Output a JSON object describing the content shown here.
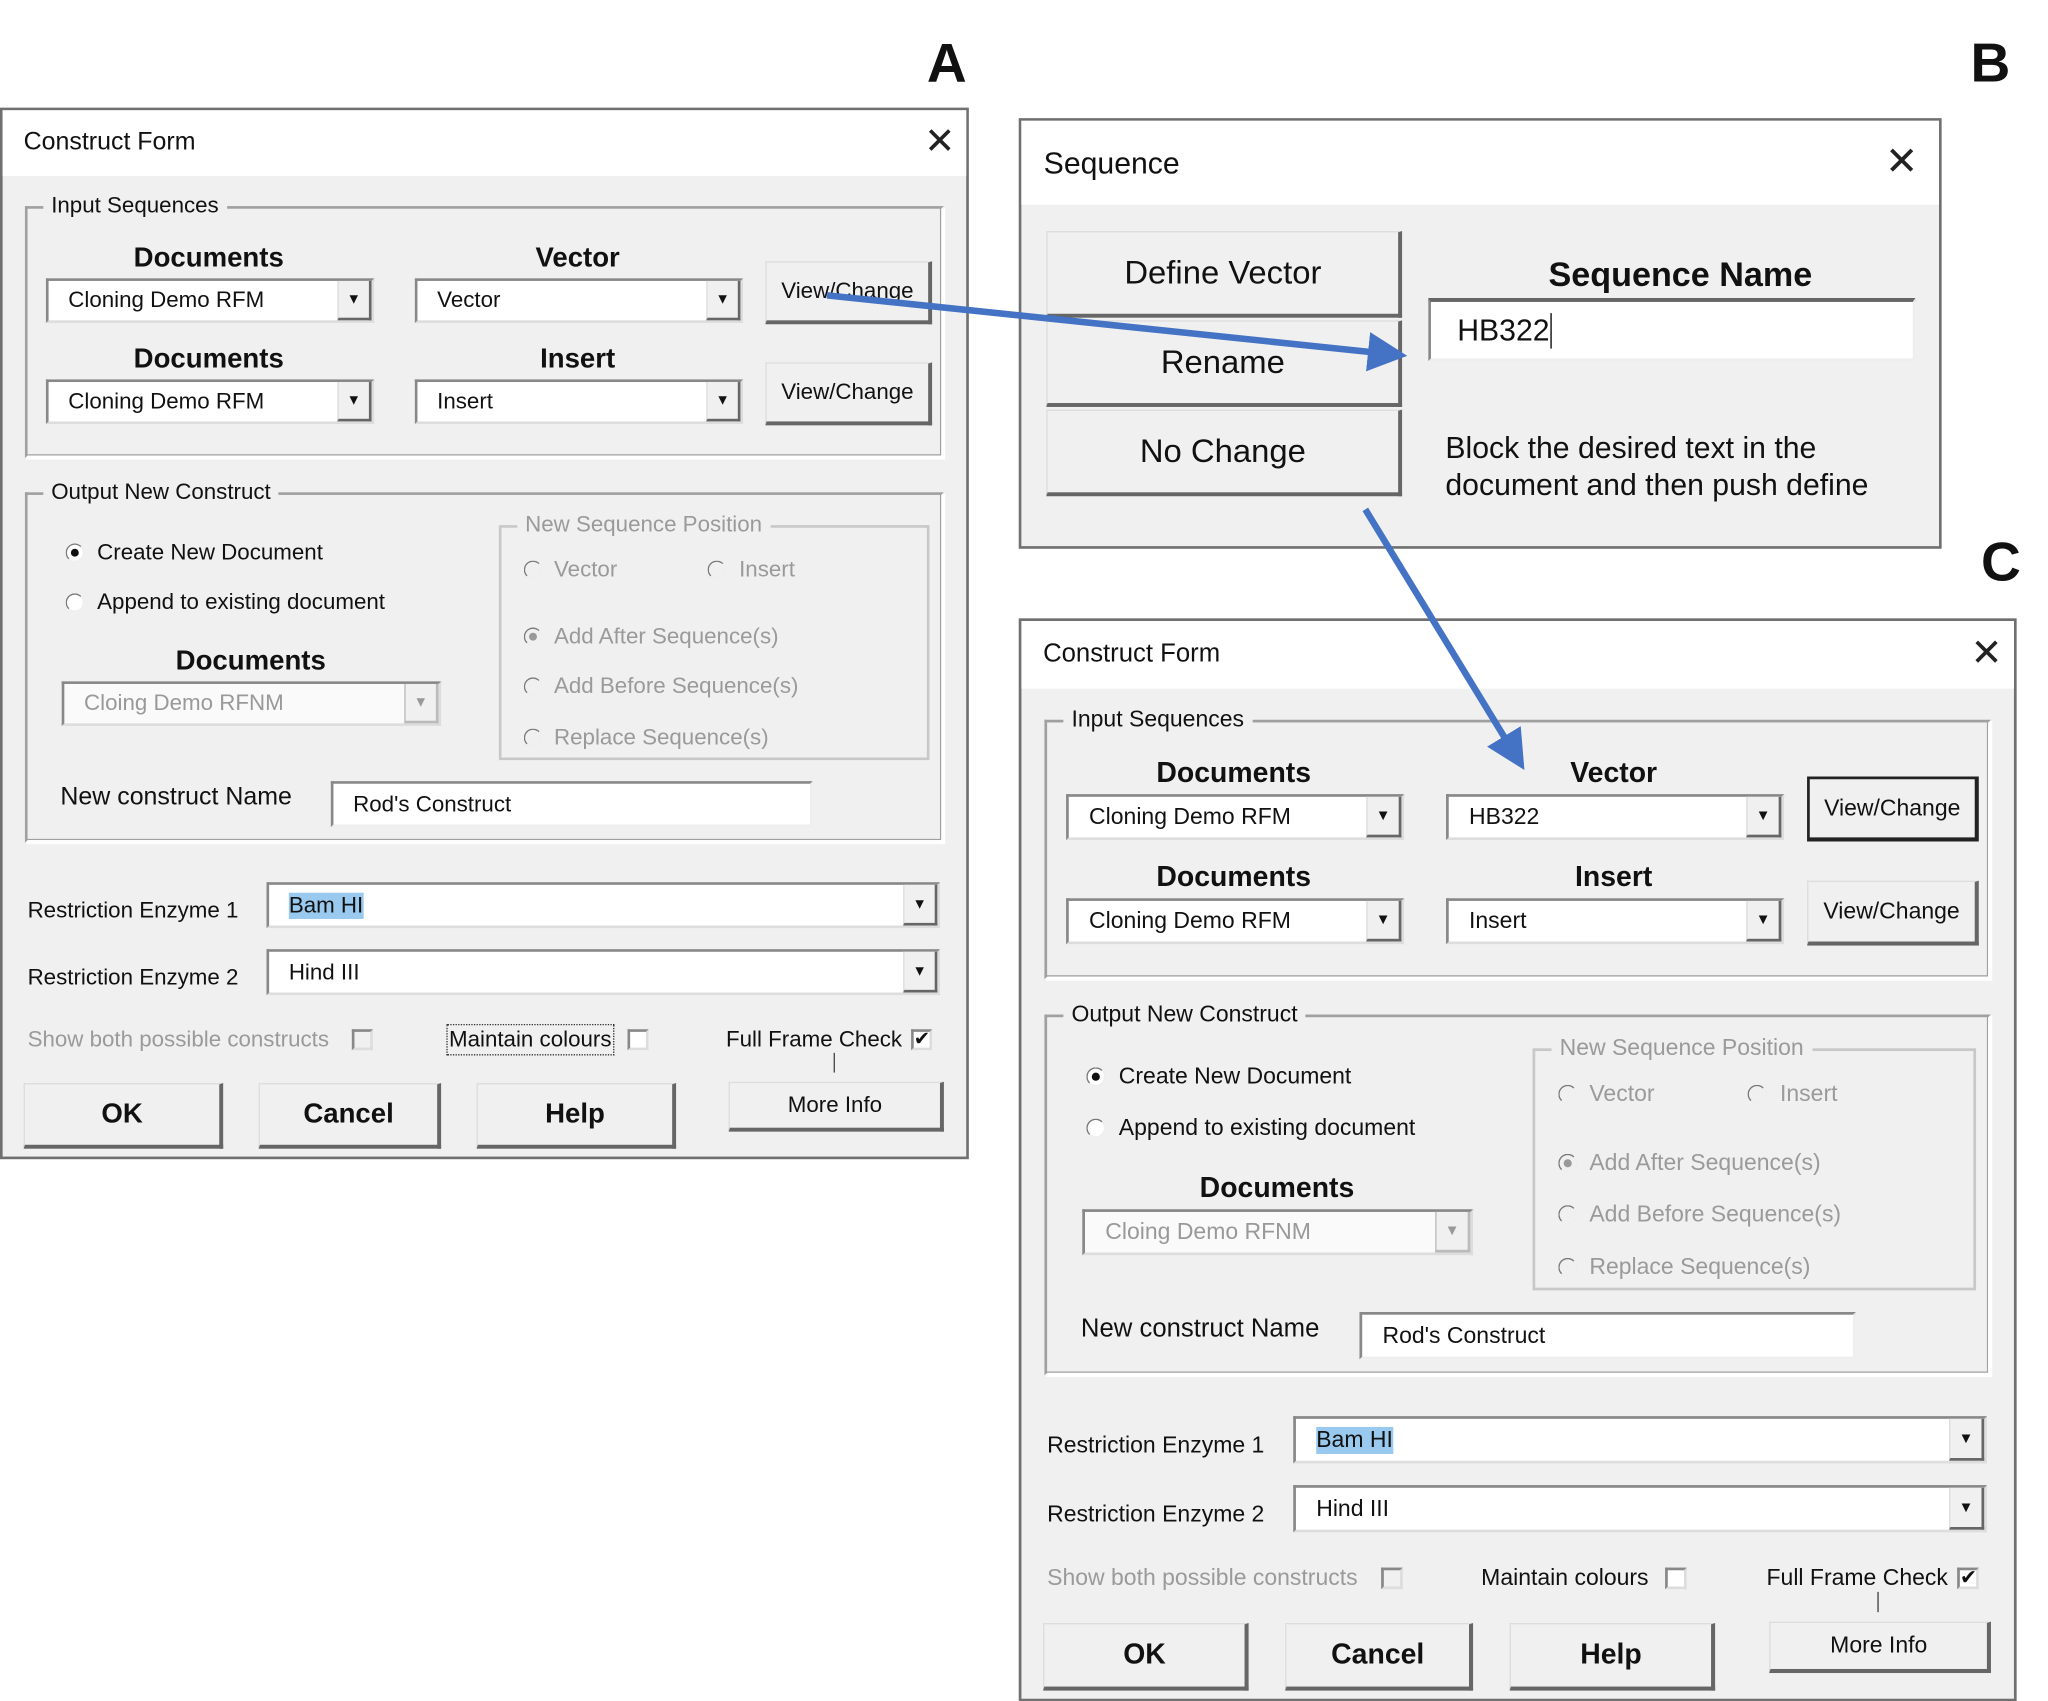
{
  "panel_letters": {
    "a": "A",
    "b": "B",
    "c": "C"
  },
  "arrow_color": "#4472c4",
  "forms": [
    {
      "title": "Construct Form",
      "input_sequences": {
        "legend": "Input Sequences",
        "documents_label_1": "Documents",
        "documents_value_1": "Cloning Demo RFM",
        "vector_label": "Vector",
        "vector_value": "Vector",
        "view_change_1": "View/Change",
        "documents_label_2": "Documents",
        "documents_value_2": "Cloning Demo RFM",
        "insert_label": "Insert",
        "insert_value": "Insert",
        "view_change_2": "View/Change"
      },
      "output": {
        "legend": "Output New Construct",
        "create_new": "Create New Document",
        "append": "Append to existing document",
        "documents_label": "Documents",
        "documents_value": "Cloing Demo RFNM",
        "new_seq_position": {
          "legend": "New Sequence Position",
          "vector": "Vector",
          "insert": "Insert",
          "add_after": "Add After Sequence(s)",
          "add_before": "Add Before Sequence(s)",
          "replace": "Replace Sequence(s)"
        },
        "new_construct_label": "New construct Name",
        "new_construct_value": "Rod's Construct"
      },
      "enzyme1_label": "Restriction Enzyme 1",
      "enzyme1_value": "Bam HI",
      "enzyme2_label": "Restriction Enzyme 2",
      "enzyme2_value": "Hind III",
      "show_both": "Show both possible constructs",
      "maintain_colours": "Maintain colours",
      "full_frame_check": "Full Frame Check",
      "full_frame_checked": "✔",
      "ok": "OK",
      "cancel": "Cancel",
      "help": "Help",
      "more_info": "More Info",
      "close_icon": "close-icon"
    },
    {
      "title": "Construct Form",
      "input_sequences": {
        "legend": "Input Sequences",
        "documents_label_1": "Documents",
        "documents_value_1": "Cloning Demo RFM",
        "vector_label": "Vector",
        "vector_value": "HB322",
        "view_change_1": "View/Change",
        "documents_label_2": "Documents",
        "documents_value_2": "Cloning Demo RFM",
        "insert_label": "Insert",
        "insert_value": "Insert",
        "view_change_2": "View/Change"
      },
      "output": {
        "legend": "Output New Construct",
        "create_new": "Create New Document",
        "append": "Append to existing document",
        "documents_label": "Documents",
        "documents_value": "Cloing Demo RFNM",
        "new_seq_position": {
          "legend": "New Sequence Position",
          "vector": "Vector",
          "insert": "Insert",
          "add_after": "Add After Sequence(s)",
          "add_before": "Add Before Sequence(s)",
          "replace": "Replace Sequence(s)"
        },
        "new_construct_label": "New construct Name",
        "new_construct_value": "Rod's Construct"
      },
      "enzyme1_label": "Restriction Enzyme 1",
      "enzyme1_value": "Bam HI",
      "enzyme2_label": "Restriction Enzyme 2",
      "enzyme2_value": "Hind III",
      "show_both": "Show both possible constructs",
      "maintain_colours": "Maintain colours",
      "full_frame_check": "Full Frame Check",
      "full_frame_checked": "✔",
      "ok": "OK",
      "cancel": "Cancel",
      "help": "Help",
      "more_info": "More Info",
      "close_icon": "close-icon"
    }
  ],
  "sequence_dialog": {
    "title": "Sequence",
    "define_vector": "Define Vector",
    "rename": "Rename",
    "no_change": "No Change",
    "sequence_name_label": "Sequence Name",
    "sequence_name_value": "HB322",
    "instructions_line1": "Block the desired text in the",
    "instructions_line2": "document and then push define"
  }
}
